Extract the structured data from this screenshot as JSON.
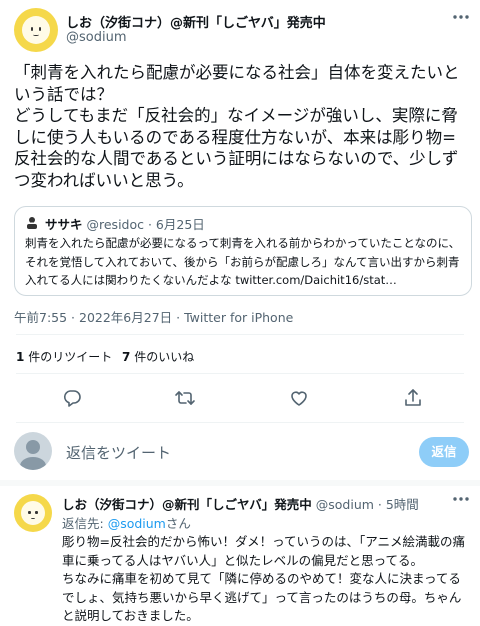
{
  "tweet": {
    "author_name": "しお（汐街コナ）@新刊「しごヤバ」発売中",
    "author_handle": "@sodium",
    "more_icon": "more-dots-icon",
    "text": "「刺青を入れたら配慮が必要になる社会」自体を変えたいという話では？\nどうしてもまだ「反社会的」なイメージが強いし、実際に脅しに使う人もいるのである程度仕方ないが、本来は彫り物=反社会的な人間であるという証明にはならないので、少しずつ変わればいいと思う。",
    "timestamp": "午前7:55 · 2022年6月27日 · Twitter for iPhone",
    "retweets_count": "1",
    "retweets_label": "件のリツイート",
    "likes_count": "7",
    "likes_label": "件のいいね"
  },
  "quote": {
    "author_name": "ササキ",
    "author_handle": "@residoc",
    "date": "· 6月25日",
    "text": "刺青を入れたら配慮が必要になるって刺青を入れる前からわかっていたことなのに、それを覚悟して入れておいて、後から「お前らが配慮しろ」なんて言い出すから刺青入れてる人には関わりたくないんだよな",
    "link": "twitter.com/Daichit16/stat…"
  },
  "actions": {
    "icons": [
      "reply-icon",
      "retweet-icon",
      "like-icon",
      "share-icon"
    ]
  },
  "reply_box": {
    "placeholder": "返信をツイート",
    "button_label": "返信"
  },
  "reply": {
    "author_name": "しお（汐街コナ）@新刊「しごヤバ」発売中",
    "author_handle": "@sodium",
    "time": "· 5時間",
    "replying_to_label": "返信先: ",
    "replying_to_handle": "@sodium",
    "replying_to_suffix": "さん",
    "text": "彫り物=反社会的だから怖い！ダメ！っていうのは、「アニメ絵満載の痛車に乗ってる人はヤバい人」と似たレベルの偏見だと思ってる。\nちなみに痛車を初めて見て「隣に停めるのやめて！変な人に決まってるでしょ、気持ち悪いから早く逃げて」って言ったのはうちの母。ちゃんと説明しておきました。"
  }
}
